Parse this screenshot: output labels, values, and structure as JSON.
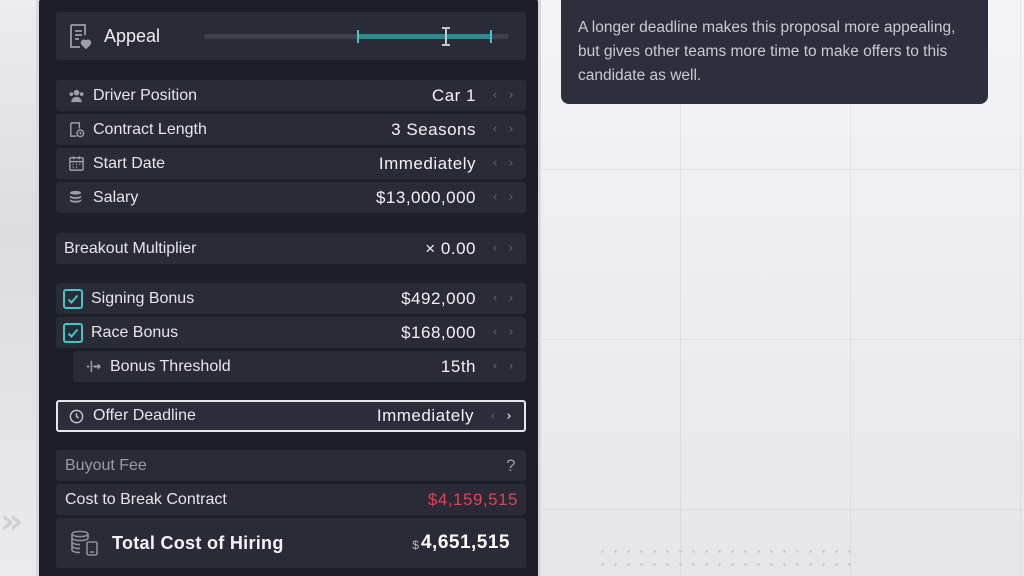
{
  "appeal": {
    "label": "Appeal",
    "range_start_pct": 0.5,
    "range_end_pct": 0.945,
    "marker_pct": 0.79
  },
  "rows": {
    "driver_position": {
      "label": "Driver Position",
      "value": "Car 1"
    },
    "contract_length": {
      "label": "Contract Length",
      "value": "3 Seasons"
    },
    "start_date": {
      "label": "Start Date",
      "value": "Immediately"
    },
    "salary": {
      "label": "Salary",
      "value": "$13,000,000"
    },
    "breakout_multiplier": {
      "label": "Breakout Multiplier",
      "value": "× 0.00"
    },
    "signing_bonus": {
      "label": "Signing Bonus",
      "value": "$492,000",
      "checked": true
    },
    "race_bonus": {
      "label": "Race Bonus",
      "value": "$168,000",
      "checked": true
    },
    "bonus_threshold": {
      "label": "Bonus Threshold",
      "value": "15th"
    },
    "offer_deadline": {
      "label": "Offer Deadline",
      "value": "Immediately"
    },
    "buyout_fee": {
      "label": "Buyout Fee",
      "value": "?"
    },
    "cost_to_break": {
      "label": "Cost to Break Contract",
      "value": "$4,159,515"
    }
  },
  "total": {
    "label": "Total Cost of Hiring",
    "currency": "$",
    "value": "4,651,515"
  },
  "tooltip": {
    "text": "A longer deadline makes this proposal more appealing, but gives other teams more time to make offers to this candidate as well."
  },
  "arrows": {
    "left": "‹",
    "right": "›"
  },
  "colors": {
    "accent": "#3ec8cc",
    "panel": "#1d1e28",
    "row": "#2a2b36",
    "warning": "#e2405a"
  }
}
